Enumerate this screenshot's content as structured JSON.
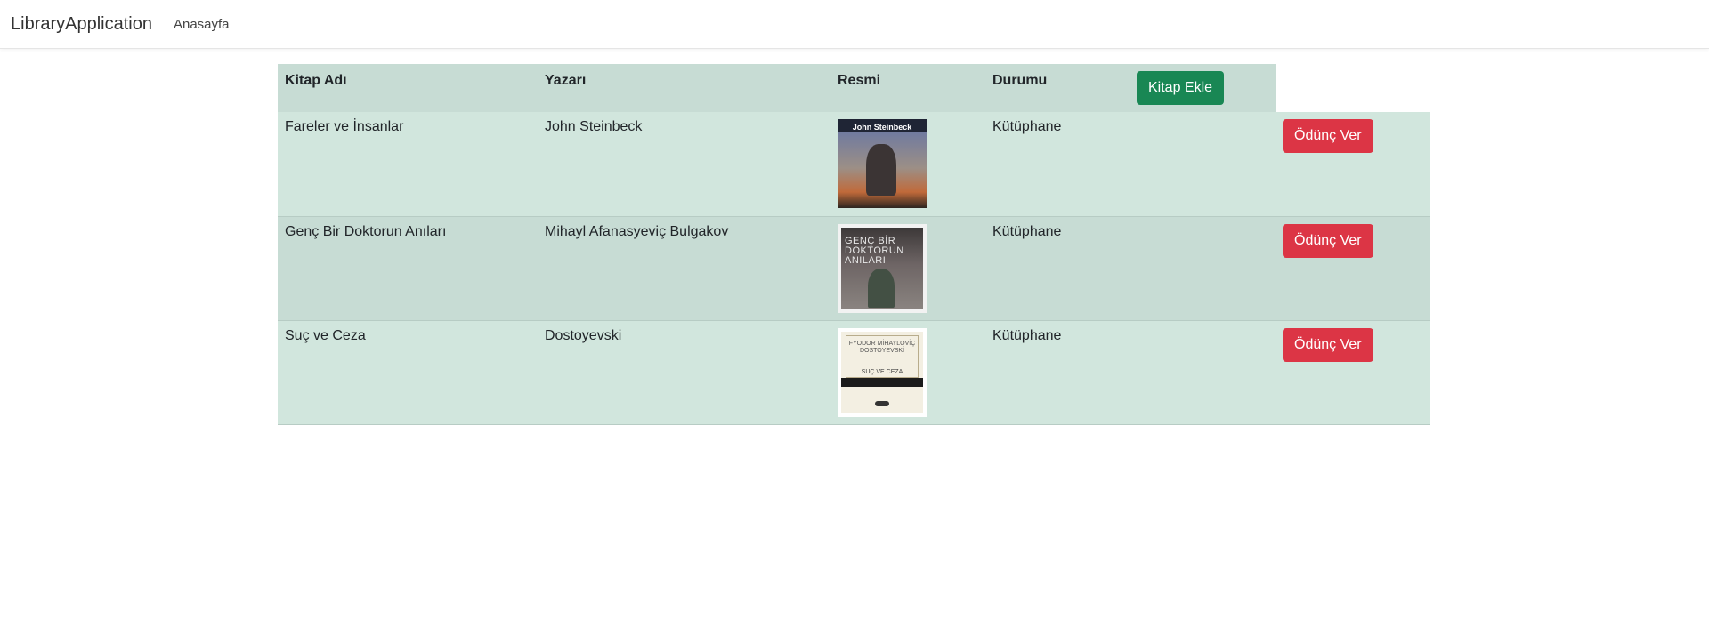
{
  "navbar": {
    "brand": "LibraryApplication",
    "links": [
      {
        "label": "Anasayfa"
      }
    ]
  },
  "table": {
    "headers": {
      "title": "Kitap Adı",
      "author": "Yazarı",
      "image": "Resmi",
      "status": "Durumu"
    },
    "add_button_label": "Kitap Ekle",
    "rows": [
      {
        "title": "Fareler ve İnsanlar",
        "author": "John Steinbeck",
        "cover_text": "John Steinbeck",
        "status": "Kütüphane",
        "action_label": "Ödünç Ver"
      },
      {
        "title": "Genç Bir Doktorun Anıları",
        "author": "Mihayl Afanasyeviç Bulgakov",
        "cover_text": "GENÇ BİR DOKTORUN ANILARI",
        "status": "Kütüphane",
        "action_label": "Ödünç Ver"
      },
      {
        "title": "Suç ve Ceza",
        "author": "Dostoyevski",
        "cover_text": "FYODOR MİHAYLOVİÇ DOSTOYEVSKİ",
        "cover_subtext": "SUÇ VE CEZA",
        "status": "Kütüphane",
        "action_label": "Ödünç Ver"
      }
    ]
  },
  "colors": {
    "header_row": "#c7dcd4",
    "row": "#d1e6dd",
    "add_button": "#198754",
    "lend_button": "#dc3545"
  }
}
